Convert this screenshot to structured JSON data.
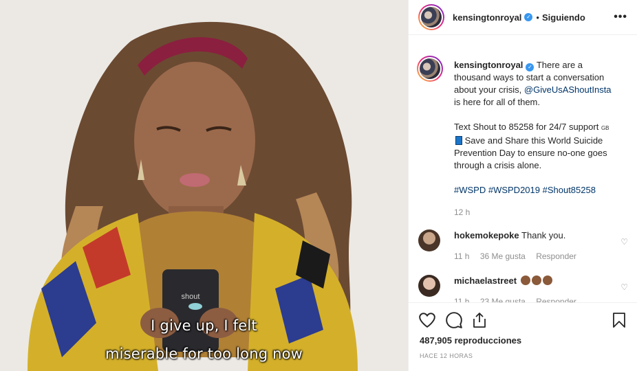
{
  "video": {
    "subtitle_line1": "I give up, I felt",
    "subtitle_line2": "miserable for too long now",
    "phone_label": "shout"
  },
  "header": {
    "username": "kensingtonroyal",
    "follow_status": "Siguiendo",
    "more_icon": "more-horizontal-icon"
  },
  "caption": {
    "username": "kensingtonroyal",
    "text_part1": "There are a thousand ways to start a conversation about your crisis,",
    "mention": "@GiveUsAShoutInsta",
    "text_part2": "is here for all of them.",
    "text_part3": "Text Shout to 85258 for 24/7 support",
    "flag_label": "GB",
    "text_part4": "Save and Share this World Suicide Prevention Day to ensure no-one goes through a crisis alone.",
    "hashtags": "#WSPD #WSPD2019 #Shout85258",
    "time": "12 h"
  },
  "comments": [
    {
      "username": "hokemokepoke",
      "text": "Thank you.",
      "time": "11 h",
      "likes": "36 Me gusta",
      "reply": "Responder"
    },
    {
      "username": "michaelastreet",
      "text": "",
      "time": "11 h",
      "likes": "23 Me gusta",
      "reply": "Responder"
    }
  ],
  "stats": {
    "views": "487,905 reproducciones",
    "posted": "HACE 12 HORAS"
  },
  "icons": [
    "like-heart-icon",
    "comment-icon",
    "share-icon",
    "bookmark-icon"
  ]
}
